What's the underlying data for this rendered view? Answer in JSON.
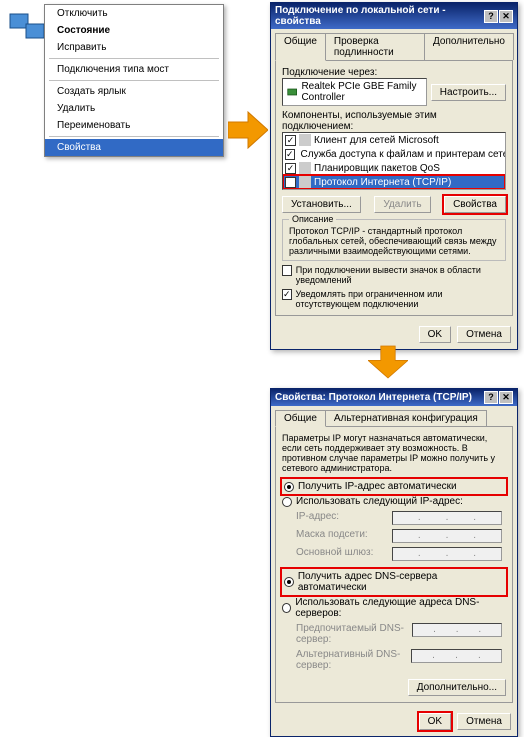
{
  "context_menu": {
    "items": [
      {
        "label": "Отключить",
        "bold": false
      },
      {
        "label": "Состояние",
        "bold": true
      },
      {
        "label": "Исправить",
        "bold": false
      }
    ],
    "items2": [
      {
        "label": "Подключения типа мост",
        "bold": false
      }
    ],
    "items3": [
      {
        "label": "Создать ярлык",
        "bold": false
      },
      {
        "label": "Удалить",
        "bold": false
      },
      {
        "label": "Переименовать",
        "bold": false
      }
    ],
    "items4": [
      {
        "label": "Свойства",
        "bold": false,
        "highlight": true
      }
    ]
  },
  "win1": {
    "title": "Подключение по локальной сети - свойства",
    "tabs": [
      "Общие",
      "Проверка подлинности",
      "Дополнительно"
    ],
    "connect_via_label": "Подключение через:",
    "adapter": "Realtek PCIe GBE Family Controller",
    "configure_btn": "Настроить...",
    "components_label": "Компоненты, используемые этим подключением:",
    "components": [
      "Клиент для сетей Microsoft",
      "Служба доступа к файлам и принтерам сетей Micro...",
      "Планировщик пакетов QoS",
      "Протокол Интернета (TCP/IP)"
    ],
    "install_btn": "Установить...",
    "remove_btn": "Удалить",
    "properties_btn": "Свойства",
    "desc_label": "Описание",
    "desc_text": "Протокол TCP/IP - стандартный протокол глобальных сетей, обеспечивающий связь между различными взаимодействующими сетями.",
    "cb1": "При подключении вывести значок в области уведомлений",
    "cb2": "Уведомлять при ограниченном или отсутствующем подключении",
    "ok_btn": "OK",
    "cancel_btn": "Отмена"
  },
  "win2": {
    "title": "Свойства: Протокол Интернета (TCP/IP)",
    "tabs": [
      "Общие",
      "Альтернативная конфигурация"
    ],
    "intro": "Параметры IP могут назначаться автоматически, если сеть поддерживает эту возможность. В противном случае параметры IP можно получить у сетевого администратора.",
    "r_auto_ip": "Получить IP-адрес автоматически",
    "r_man_ip": "Использовать следующий IP-адрес:",
    "ip_label": "IP-адрес:",
    "mask_label": "Маска подсети:",
    "gw_label": "Основной шлюз:",
    "r_auto_dns": "Получить адрес DNS-сервера автоматически",
    "r_man_dns": "Использовать следующие адреса DNS-серверов:",
    "dns1_label": "Предпочитаемый DNS-сервер:",
    "dns2_label": "Альтернативный DNS-сервер:",
    "adv_btn": "Дополнительно...",
    "ok_btn": "OK",
    "cancel_btn": "Отмена"
  }
}
